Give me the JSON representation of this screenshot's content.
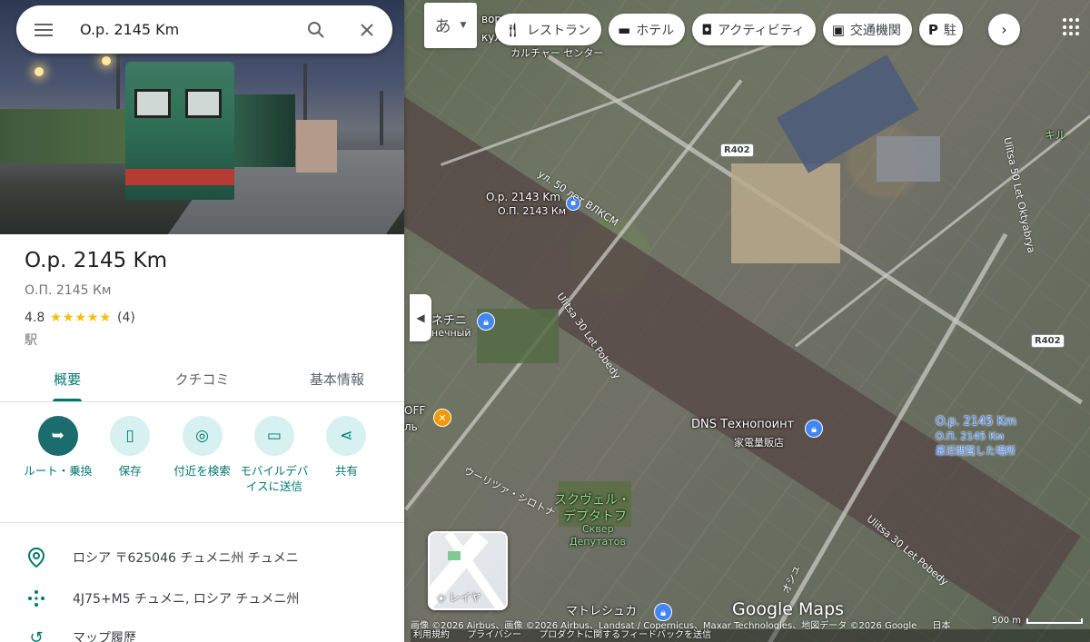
{
  "search": {
    "value": "O.p. 2145 Km"
  },
  "place": {
    "title": "O.p. 2145 Km",
    "subtitle": "О.П. 2145 Км",
    "rating": "4.8",
    "stars": "★★★★★",
    "review_count": "(4)",
    "category": "駅"
  },
  "tabs": [
    {
      "label": "概要"
    },
    {
      "label": "クチコミ"
    },
    {
      "label": "基本情報"
    }
  ],
  "actions": [
    {
      "label": "ルート・乗換",
      "icon": "directions-icon"
    },
    {
      "label": "保存",
      "icon": "bookmark-icon"
    },
    {
      "label": "付近を検索",
      "icon": "nearby-icon"
    },
    {
      "label": "モバイルデバイスに送信",
      "icon": "send-to-phone-icon"
    },
    {
      "label": "共有",
      "icon": "share-icon"
    }
  ],
  "info": {
    "address": "ロシア 〒625046 チュメニ州 チュメニ",
    "plus_code": "4J75+M5 チュメニ, ロシア チュメニ州",
    "history": "マップ履歴"
  },
  "language_button": "あ",
  "chips": [
    {
      "label": "レストラン",
      "icon": "restaurant-icon"
    },
    {
      "label": "ホテル",
      "icon": "hotel-icon"
    },
    {
      "label": "アクティビティ",
      "icon": "camera-icon"
    },
    {
      "label": "交通機関",
      "icon": "transit-icon"
    },
    {
      "label": "駐",
      "icon": "parking-icon"
    }
  ],
  "map": {
    "labels": {
      "culture_center": "カルチャー センター",
      "culture_top": "ворец",
      "culture_top2": "куль",
      "op2143": "O.p. 2143 Km",
      "op2143_ru": "О.П. 2143 Км",
      "road_50let": "ул. 50 лет ВЛКСМ",
      "road_30let": "Ulitsa 30 Let Pobedy",
      "road_30let_b": "Ulitsa 30 Let Pobedy",
      "road_50oktyabrya": "Ulitsa 50 Let Oktyabrya",
      "route_r402": "R402",
      "route_r402_b": "R402",
      "dns": "DNS Технопоинт",
      "dns_sub": "家電量販店",
      "op2145": "O.p. 2145 Km",
      "op2145_ru": "О.П. 2145 Км",
      "op2145_note": "最近閲覧した場所",
      "square": "スクヴェル・",
      "square2": "デプタトフ",
      "square_ru": "Сквер",
      "square_ru2": "Депутатов",
      "nechny": "ネチニ",
      "nechny_ru": "нечный",
      "off_label": "OFF",
      "off_label2": "ль",
      "matreshka": "マトレシュカ",
      "uritsa": "ウーリツァ・シロトナ",
      "kirov": "キル",
      "osh": "オシュ"
    },
    "layers_label": "レイヤ",
    "google": "Google Maps",
    "attribution": "画像 ©2026 Airbus、画像 ©2026 Airbus、Landsat / Copernicus、Maxar Technologies、地図データ ©2026 Google",
    "country": "日本",
    "scale": "500 m",
    "footer_links": [
      "利用規約",
      "プライバシー",
      "プロダクトに関するフィードバックを送信"
    ]
  },
  "colors": {
    "accent": "#00796b",
    "pin": "#ea4335",
    "star": "#fbbc04"
  }
}
